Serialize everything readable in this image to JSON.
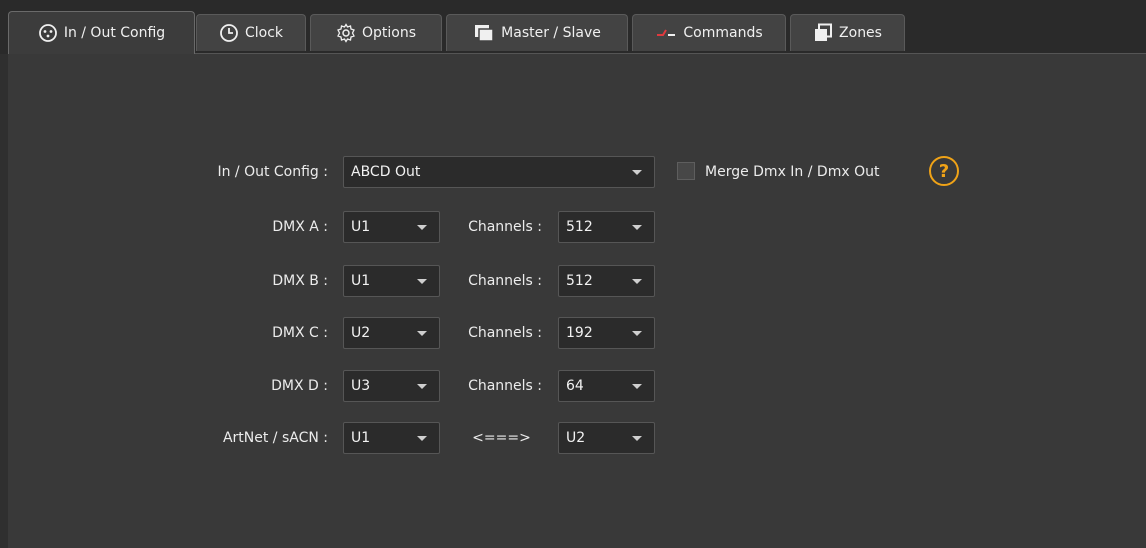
{
  "tabs": [
    {
      "label": "In / Out Config",
      "icon": "xlr-connector-icon",
      "active": true
    },
    {
      "label": "Clock",
      "icon": "clock-icon"
    },
    {
      "label": "Options",
      "icon": "gear-icon"
    },
    {
      "label": "Master / Slave",
      "icon": "windows-stack-icon"
    },
    {
      "label": "Commands",
      "icon": "command-line-icon"
    },
    {
      "label": "Zones",
      "icon": "zones-icon"
    }
  ],
  "config": {
    "label": "In / Out Config :",
    "value": "ABCD Out",
    "merge_label": "Merge Dmx In / Dmx Out",
    "merge_checked": false,
    "help_symbol": "?"
  },
  "channels_label": "Channels :",
  "rows": [
    {
      "label": "DMX A :",
      "universe": "U1",
      "channels": "512"
    },
    {
      "label": "DMX B :",
      "universe": "U1",
      "channels": "512"
    },
    {
      "label": "DMX C :",
      "universe": "U2",
      "channels": "192"
    },
    {
      "label": "DMX D :",
      "universe": "U3",
      "channels": "64"
    }
  ],
  "artnet": {
    "label": "ArtNet / sACN :",
    "universe_from": "U1",
    "arrow_text": "<===>",
    "universe_to": "U2"
  },
  "colors": {
    "accent": "#f0a317",
    "panel_bg": "#393939",
    "window_bg": "#2f2f2f"
  }
}
